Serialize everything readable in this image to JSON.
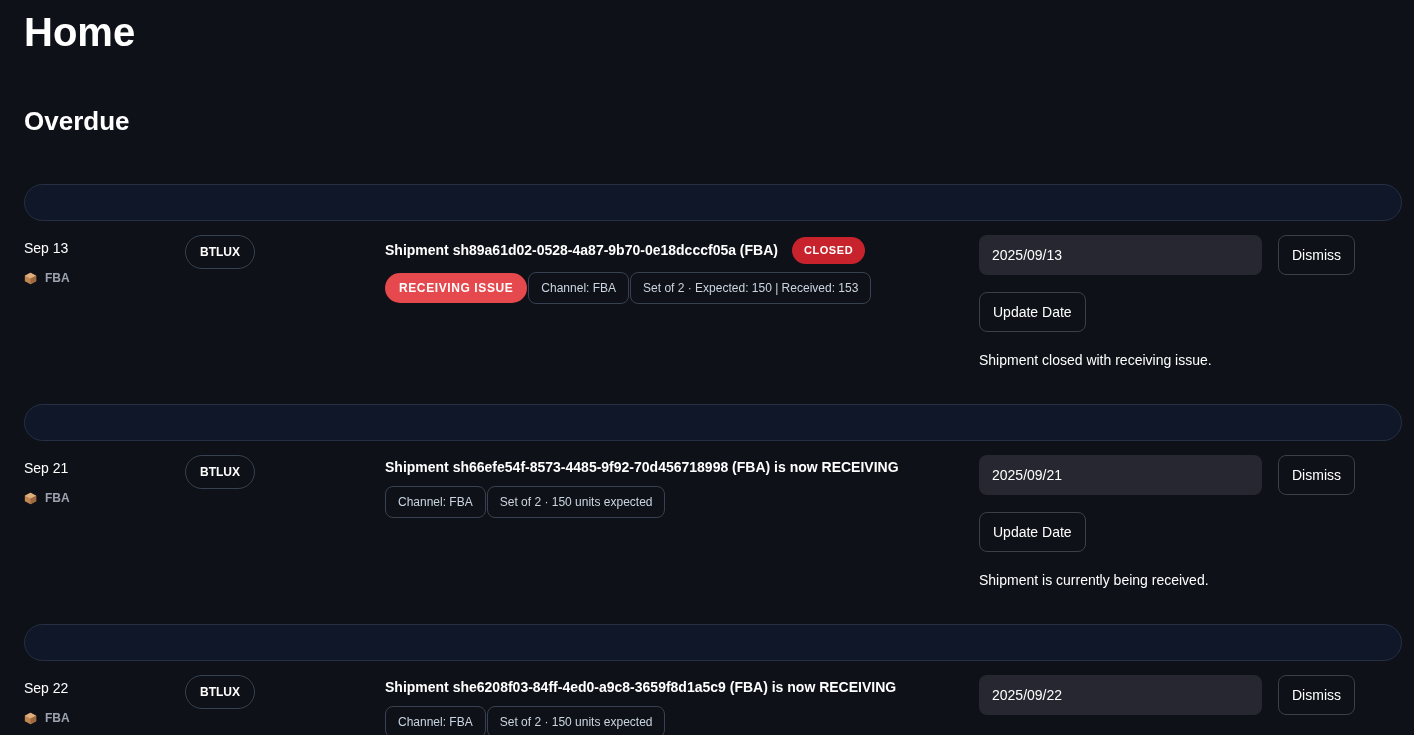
{
  "title": "Home",
  "section": "Overdue",
  "items": [
    {
      "date": "Sep 13",
      "channel_icon_label": "FBA",
      "tag": "BTLUX",
      "headline": "Shipment sh89a61d02-0528-4a87-9b70-0e18dcccf05a (FBA)",
      "status_badge": "CLOSED",
      "chips": [
        {
          "label": "RECEIVING ISSUE",
          "kind": "alert"
        },
        {
          "label": "Channel: FBA",
          "kind": "outline"
        },
        {
          "label": "Set of 2 · Expected: 150 | Received: 153",
          "kind": "outline"
        }
      ],
      "date_value": "2025/09/13",
      "dismiss": "Dismiss",
      "update": "Update Date",
      "note": "Shipment closed with receiving issue."
    },
    {
      "date": "Sep 21",
      "channel_icon_label": "FBA",
      "tag": "BTLUX",
      "headline": "Shipment sh66efe54f-8573-4485-9f92-70d456718998 (FBA) is now RECEIVING",
      "chips": [
        {
          "label": "Channel: FBA",
          "kind": "outline"
        },
        {
          "label": "Set of 2 · 150 units expected",
          "kind": "outline"
        }
      ],
      "date_value": "2025/09/21",
      "dismiss": "Dismiss",
      "update": "Update Date",
      "note": "Shipment is currently being received."
    },
    {
      "date": "Sep 22",
      "channel_icon_label": "FBA",
      "tag": "BTLUX",
      "headline": "Shipment she6208f03-84ff-4ed0-a9c8-3659f8d1a5c9 (FBA) is now RECEIVING",
      "chips": [
        {
          "label": "Channel: FBA",
          "kind": "outline"
        },
        {
          "label": "Set of 2 · 150 units expected",
          "kind": "outline"
        }
      ],
      "date_value": "2025/09/22",
      "dismiss": "Dismiss"
    }
  ]
}
